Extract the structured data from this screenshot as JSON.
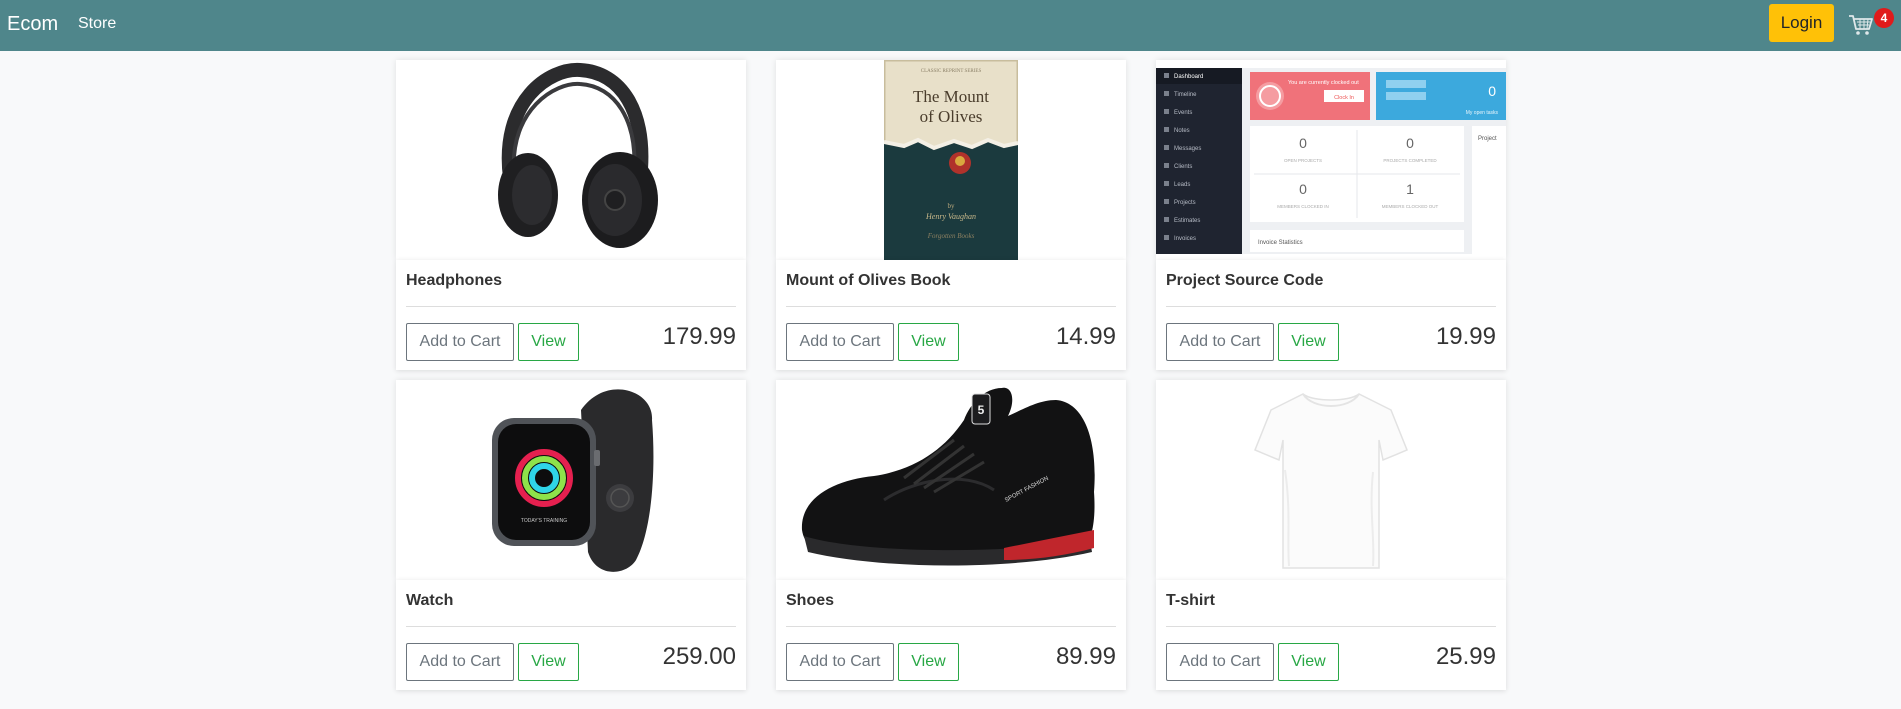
{
  "navbar": {
    "brand": "Ecom",
    "store_link": "Store",
    "login_label": "Login",
    "cart_count": "4"
  },
  "products": [
    {
      "name": "Headphones",
      "price": "179.99",
      "add_label": "Add to Cart",
      "view_label": "View"
    },
    {
      "name": "Mount of Olives Book",
      "price": "14.99",
      "add_label": "Add to Cart",
      "view_label": "View"
    },
    {
      "name": "Project Source Code",
      "price": "19.99",
      "add_label": "Add to Cart",
      "view_label": "View"
    },
    {
      "name": "Watch",
      "price": "259.00",
      "add_label": "Add to Cart",
      "view_label": "View"
    },
    {
      "name": "Shoes",
      "price": "89.99",
      "add_label": "Add to Cart",
      "view_label": "View"
    },
    {
      "name": "T-shirt",
      "price": "25.99",
      "add_label": "Add to Cart",
      "view_label": "View"
    }
  ],
  "book_cover": {
    "series": "CLASSIC REPRINT SERIES",
    "title_line1": "The Mount",
    "title_line2": "of Olives",
    "author": "Henry Vaughan",
    "publisher": "Forgotten Books"
  },
  "dashboard_thumb": {
    "menu": [
      "Dashboard",
      "Timeline",
      "Events",
      "Notes",
      "Messages",
      "Clients",
      "Leads",
      "Projects",
      "Estimates",
      "Invoices"
    ],
    "alert_text": "You are currently clocked out",
    "clock_button": "Clock In",
    "open_tasks_value": "0",
    "open_tasks_label": "My open tasks",
    "stats": [
      {
        "value": "0",
        "label": "OPEN PROJECTS"
      },
      {
        "value": "0",
        "label": "PROJECTS COMPLETED"
      },
      {
        "value": "0",
        "label": "MEMBERS CLOCKED IN"
      },
      {
        "value": "1",
        "label": "MEMBERS CLOCKED OUT"
      }
    ],
    "invoice_label": "Invoice Statistics",
    "project_label": "Project"
  },
  "watch_face": {
    "label": "TODAY'S TRAINING"
  },
  "shoe_print": {
    "label": "SPORT FASHION"
  },
  "colors": {
    "navbar": "#4f868b",
    "login": "#ffc107",
    "badge": "#e01b1b",
    "view_button": "#28a745",
    "add_button": "#6c757d"
  }
}
